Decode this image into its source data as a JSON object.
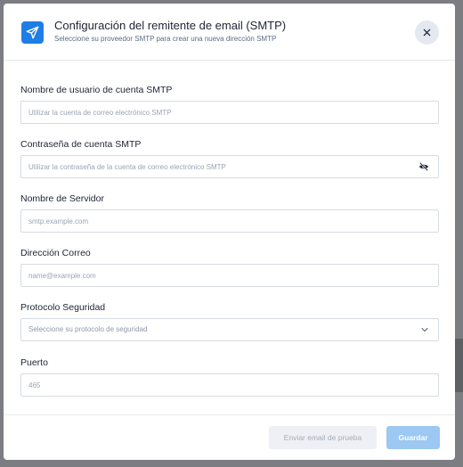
{
  "header": {
    "title": "Configuración del remitente de email (SMTP)",
    "subtitle": "Seleccione su proveedor SMTP para crear una nueva dirección SMTP",
    "icon": "paper-plane-icon",
    "close_icon": "close-icon"
  },
  "form": {
    "username": {
      "label": "Nombre de usuario de cuenta SMTP",
      "value": "",
      "placeholder": "Utilizar la cuenta de correo electrónico SMTP"
    },
    "password": {
      "label": "Contraseña de cuenta SMTP",
      "value": "",
      "placeholder": "Utilizar la contraseña de la cuenta de correo electrónico SMTP",
      "toggle_icon": "eye-slash-icon"
    },
    "server": {
      "label": "Nombre de Servidor",
      "value": "",
      "placeholder": "smtp.example.com"
    },
    "email": {
      "label": "Dirección Correo",
      "value": "",
      "placeholder": "name@example.com"
    },
    "protocol": {
      "label": "Protocolo Seguridad",
      "selected": "Seleccione su protocolo de seguridad",
      "icon": "chevron-down-icon"
    },
    "port": {
      "label": "Puerto",
      "value": "",
      "placeholder": "465"
    }
  },
  "footer": {
    "test_label": "Enviar email de prueba",
    "save_label": "Guardar"
  },
  "colors": {
    "accent": "#1f7de6",
    "save_button": "#9cc8f2",
    "test_button": "#eef0f5",
    "border": "#d7dbe3",
    "backdrop": "#7b7d82"
  }
}
